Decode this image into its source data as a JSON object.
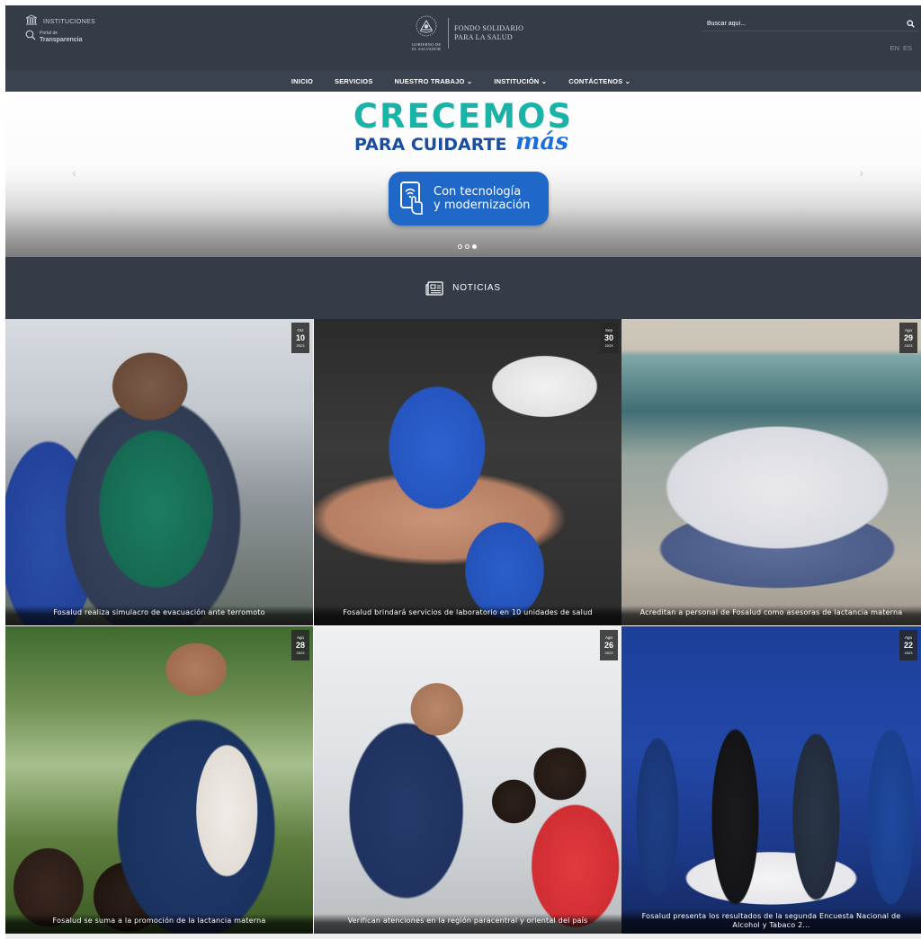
{
  "header": {
    "instituciones": "INSTITUCIONES",
    "transparencia_small": "Portal de",
    "transparencia": "Transparencia",
    "gov_line1": "GOBIERNO DE",
    "gov_line2": "EL SALVADOR",
    "brand_line1": "FONDO SOLIDARIO",
    "brand_line2": "PARA LA SALUD",
    "search_placeholder": "Buscar aquí...",
    "languages": [
      "EN",
      "ES"
    ]
  },
  "nav": {
    "items": [
      "INICIO",
      "SERVICIOS",
      "NUESTRO TRABAJO ⌄",
      "INSTITUCIÓN ⌄",
      "CONTÁCTENOS ⌄"
    ]
  },
  "hero": {
    "title": "CRECEMOS",
    "subtitle": "PARA CUIDARTE",
    "accent": "más",
    "cta_line1": "Con tecnología",
    "cta_line2": "y modernización",
    "slide_count": 3,
    "active_slide": 3
  },
  "news": {
    "heading": "NOTICIAS",
    "items": [
      {
        "month": "Oct",
        "day": "10",
        "year": "2023",
        "title": "Fosalud realiza simulacro de evacuación ante terromoto"
      },
      {
        "month": "Sep",
        "day": "30",
        "year": "2023",
        "title": "Fosalud brindará servicios de laboratorio en 10 unidades de salud"
      },
      {
        "month": "Ago",
        "day": "29",
        "year": "2023",
        "title": "Acreditan a personal de Fosalud como asesoras de lactancia materna"
      },
      {
        "month": "Ago",
        "day": "28",
        "year": "2023",
        "title": "Fosalud se suma a la promoción de la lactancia materna"
      },
      {
        "month": "Ago",
        "day": "26",
        "year": "2023",
        "title": "Verifican atenciones en la región paracentral y oriental del país"
      },
      {
        "month": "Ago",
        "day": "22",
        "year": "2023",
        "title": "Fosalud presenta los resultados de la segunda Encuesta Nacional de Alcohol y Tabaco 2..."
      }
    ]
  },
  "colors": {
    "header_bg": "#353c48",
    "nav_bg": "#3a4250",
    "hero_teal": "#1ab3a7",
    "hero_blue": "#1a4da0",
    "cta_blue": "#1f68c8"
  },
  "icons": [
    "building-icon",
    "magnifier-icon",
    "coat-of-arms-icon",
    "search-icon",
    "tablet-touch-icon",
    "newspaper-icon"
  ]
}
